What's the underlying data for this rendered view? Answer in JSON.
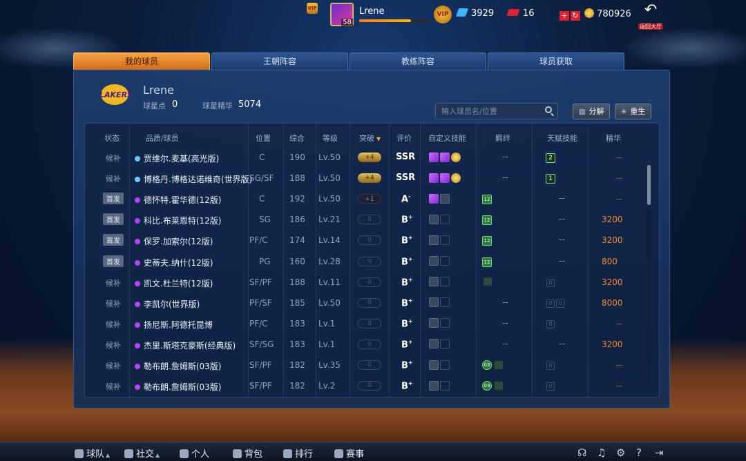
{
  "topbar": {
    "vip_small_label": "VIP",
    "player_name": "Lrene",
    "player_level": "58",
    "exp_percent": 74,
    "vip_label": "VIP",
    "gems": "3929",
    "tickets": "16",
    "coins": "780926",
    "back_label": "返回大厅"
  },
  "tabs": [
    "我的球员",
    "王朝阵容",
    "教练阵容",
    "球员获取"
  ],
  "team": {
    "logo_text": "LAKERS",
    "owner": "Lrene",
    "star_points_label": "球星点",
    "star_points": "0",
    "essence_label": "球星精华",
    "essence": "5074"
  },
  "search": {
    "placeholder": "输入球员名/位置"
  },
  "buttons": {
    "decompose": "分解",
    "rebirth": "重生"
  },
  "columns": [
    "状态",
    "品质/球员",
    "位置",
    "综合",
    "等级",
    "突破",
    "评价",
    "自定义技能",
    "羁绊",
    "天赋技能",
    "精华"
  ],
  "rows": [
    {
      "status": "候补",
      "status_type": "bench",
      "quality": "blue",
      "name": "贾维尔.麦基(高光版)",
      "position": "C",
      "overall": "190",
      "level": "Lv.50",
      "breakthrough": "+4",
      "break_type": "gold",
      "grade": "SSR",
      "grade_sup": "",
      "skills": [
        "purple",
        "purple",
        "gold"
      ],
      "bond": "--",
      "bond_type": "text",
      "talent": "2",
      "talent_type": "box",
      "essence": "--"
    },
    {
      "status": "候补",
      "status_type": "bench",
      "quality": "blue",
      "name": "博格丹.博格达诺维奇(世界版)",
      "position": "SG/SF",
      "overall": "188",
      "level": "Lv.50",
      "breakthrough": "+4",
      "break_type": "gold",
      "grade": "SSR",
      "grade_sup": "",
      "skills": [
        "purple",
        "purple",
        "gold"
      ],
      "bond": "--",
      "bond_type": "text",
      "talent": "1",
      "talent_type": "box",
      "essence": "--"
    },
    {
      "status": "首发",
      "status_type": "start",
      "quality": "purple",
      "name": "德怀特.霍华德(12版)",
      "position": "C",
      "overall": "192",
      "level": "Lv.50",
      "breakthrough": "+1",
      "break_type": "dark",
      "grade": "A",
      "grade_sup": "-",
      "skills": [
        "purple",
        "lock"
      ],
      "bond": "12",
      "bond_type": "badge",
      "talent": "--",
      "talent_type": "text",
      "essence": "--"
    },
    {
      "status": "首发",
      "status_type": "start",
      "quality": "purple",
      "name": "科比.布莱恩特(12版)",
      "position": "SG",
      "overall": "186",
      "level": "Lv.21",
      "breakthrough": "0",
      "break_type": "empty",
      "grade": "B",
      "grade_sup": "+",
      "skills": [
        "lock",
        "empty"
      ],
      "bond": "12",
      "bond_type": "badge",
      "talent": "--",
      "talent_type": "text",
      "essence": "3200"
    },
    {
      "status": "首发",
      "status_type": "start",
      "quality": "purple",
      "name": "保罗.加索尔(12版)",
      "position": "PF/C",
      "overall": "174",
      "level": "Lv.14",
      "breakthrough": "0",
      "break_type": "empty",
      "grade": "B",
      "grade_sup": "+",
      "skills": [
        "lock",
        "empty"
      ],
      "bond": "12",
      "bond_type": "badge",
      "talent": "--",
      "talent_type": "text",
      "essence": "3200"
    },
    {
      "status": "首发",
      "status_type": "start",
      "quality": "purple",
      "name": "史蒂夫.纳什(12版)",
      "position": "PG",
      "overall": "160",
      "level": "Lv.28",
      "breakthrough": "0",
      "break_type": "empty",
      "grade": "B",
      "grade_sup": "+",
      "skills": [
        "lock",
        "empty"
      ],
      "bond": "12",
      "bond_type": "badge",
      "talent": "--",
      "talent_type": "text",
      "essence": "800"
    },
    {
      "status": "候补",
      "status_type": "bench",
      "quality": "purple",
      "name": "凯文.杜兰特(12版)",
      "position": "SF/PF",
      "overall": "188",
      "level": "Lv.11",
      "breakthrough": "0",
      "break_type": "empty",
      "grade": "B",
      "grade_sup": "+",
      "skills": [
        "lock",
        "empty"
      ],
      "bond": "",
      "bond_type": "dim",
      "talent": "0",
      "talent_type": "empty1",
      "essence": "3200"
    },
    {
      "status": "候补",
      "status_type": "bench",
      "quality": "purple",
      "name": "李凯尔(世界版)",
      "position": "PF/SF",
      "overall": "185",
      "level": "Lv.50",
      "breakthrough": "0",
      "break_type": "empty",
      "grade": "B",
      "grade_sup": "+",
      "skills": [
        "lock",
        "empty"
      ],
      "bond": "--",
      "bond_type": "text",
      "talent": "0",
      "talent_type": "empty2",
      "essence": "8000"
    },
    {
      "status": "候补",
      "status_type": "bench",
      "quality": "purple",
      "name": "扬尼斯.阿德托昆博",
      "position": "PF/C",
      "overall": "183",
      "level": "Lv.1",
      "breakthrough": "0",
      "break_type": "empty",
      "grade": "B",
      "grade_sup": "+",
      "skills": [
        "lock",
        "empty"
      ],
      "bond": "--",
      "bond_type": "text",
      "talent": "0",
      "talent_type": "empty1",
      "essence": "--"
    },
    {
      "status": "候补",
      "status_type": "bench",
      "quality": "purple",
      "name": "杰里.斯塔克豪斯(经典版)",
      "position": "SF/SG",
      "overall": "183",
      "level": "Lv.1",
      "breakthrough": "0",
      "break_type": "empty",
      "grade": "B",
      "grade_sup": "+",
      "skills": [
        "lock",
        "empty"
      ],
      "bond": "--",
      "bond_type": "text",
      "talent": "--",
      "talent_type": "text",
      "essence": "3200"
    },
    {
      "status": "候补",
      "status_type": "bench",
      "quality": "purple",
      "name": "勒布朗.詹姆斯(03版)",
      "position": "SF/PF",
      "overall": "182",
      "level": "Lv.35",
      "breakthrough": "0",
      "break_type": "empty",
      "grade": "B",
      "grade_sup": "+",
      "skills": [
        "lock",
        "empty"
      ],
      "bond": "03",
      "bond_type": "circle",
      "talent": "0",
      "talent_type": "empty1",
      "essence": "--"
    },
    {
      "status": "候补",
      "status_type": "bench",
      "quality": "purple",
      "name": "勒布朗.詹姆斯(03版)",
      "position": "SF/PF",
      "overall": "182",
      "level": "Lv.2",
      "breakthrough": "0",
      "break_type": "empty",
      "grade": "B",
      "grade_sup": "+",
      "skills": [
        "lock",
        "empty"
      ],
      "bond": "03",
      "bond_type": "circle",
      "talent": "0",
      "talent_type": "empty1",
      "essence": "--"
    }
  ],
  "bottom_nav": [
    "球队",
    "社交",
    "个人",
    "背包",
    "排行",
    "赛事"
  ],
  "colors": {
    "accent_orange": "#f0892e",
    "tab_active": "#e8902f",
    "panel": "#1e3e6e"
  }
}
